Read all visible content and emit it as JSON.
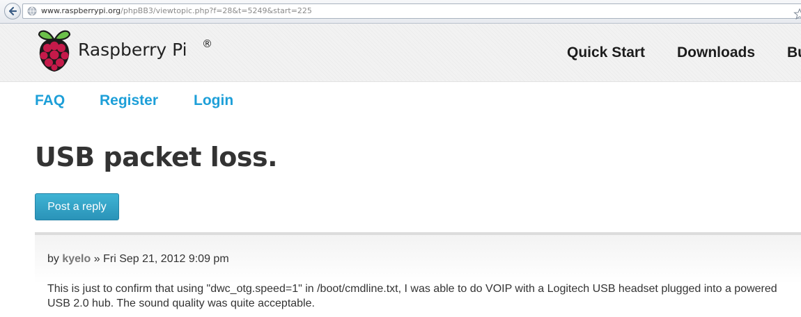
{
  "browser": {
    "url_domain": "www.raspberrypi.org",
    "url_path": "/phpBB3/viewtopic.php?f=28&t=5249&start=225"
  },
  "site": {
    "name": "Raspberry Pi",
    "registered_mark": "®",
    "brand_colors": {
      "raspberry_red": "#c51a4a",
      "leaf_green": "#6cc04a",
      "link_blue": "#1d9fd8"
    }
  },
  "main_nav": {
    "items": [
      "Quick Start",
      "Downloads",
      "Bu"
    ]
  },
  "forum_nav": {
    "items": [
      "FAQ",
      "Register",
      "Login"
    ]
  },
  "topic": {
    "title": "USB packet loss.",
    "reply_button_label": "Post a reply"
  },
  "post": {
    "by_label": "by",
    "author": "kyelo",
    "separator": "»",
    "date": "Fri Sep 21, 2012 9:09 pm",
    "body": "This is just to confirm that using \"dwc_otg.speed=1\" in /boot/cmdline.txt, I was able to do VOIP with a Logitech USB headset plugged into a powered USB 2.0 hub. The sound quality was quite acceptable."
  },
  "icons": {
    "back": "back-arrow-icon",
    "site": "globe-icon",
    "bookmark": "star-icon",
    "menu": "dropdown-arrow-icon",
    "logo": "raspberry-logo-icon"
  }
}
